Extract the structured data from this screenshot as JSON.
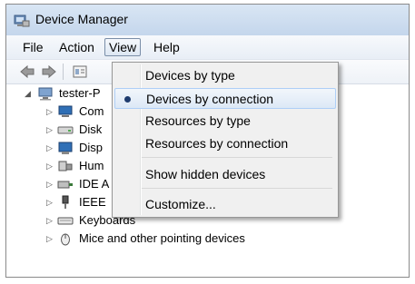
{
  "window": {
    "title": "Device Manager"
  },
  "menubar": {
    "items": [
      "File",
      "Action",
      "View",
      "Help"
    ]
  },
  "tree": {
    "root": "tester-P",
    "children": [
      "Com",
      "Disk",
      "Disp",
      "Hum",
      "IDE A",
      "IEEE",
      "Keyboards",
      "Mice and other pointing devices"
    ]
  },
  "view_menu": {
    "items": [
      {
        "label": "Devices by type"
      },
      {
        "label": "Devices by connection",
        "checked": true
      },
      {
        "label": "Resources by type"
      },
      {
        "label": "Resources by connection"
      },
      {
        "label": "Show hidden devices"
      },
      {
        "label": "Customize..."
      }
    ]
  },
  "colors": {
    "menu_hover_border": "#aecff7",
    "titlebar": "#c4d6ec",
    "radio": "#1e3c6e"
  }
}
